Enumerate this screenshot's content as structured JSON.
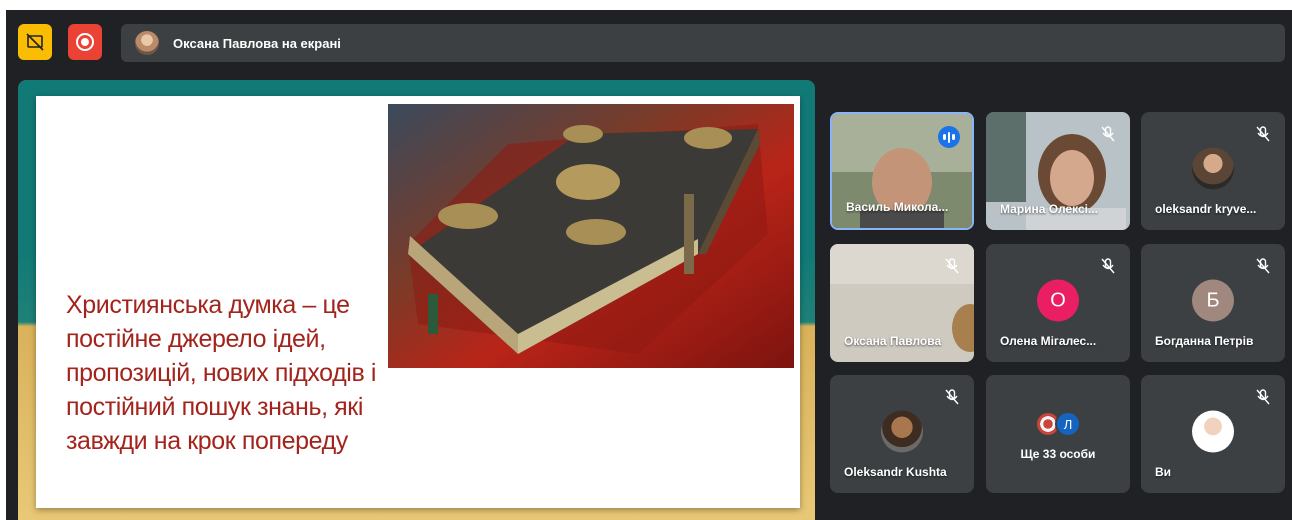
{
  "topbar": {
    "presenter_banner": "Оксана Павлова на екрані",
    "icons": [
      "present-to-all-icon",
      "record-icon"
    ]
  },
  "presentation": {
    "slide_text": "Християнська думка – це постійне джерело ідей, пропозицій, нових підходів і постійний пошук знань, які завжди на крок попереду"
  },
  "participants": [
    {
      "name": "Василь Микола...",
      "state": "speaking"
    },
    {
      "name": "Марина Олексі...",
      "state": "muted"
    },
    {
      "name": "oleksandr kryve...",
      "state": "muted"
    },
    {
      "name": "Оксана Павлова",
      "state": "muted"
    },
    {
      "name": "Олена Мігалес...",
      "initial": "О",
      "state": "muted"
    },
    {
      "name": "Богданна Петрів",
      "initial": "Б",
      "state": "muted"
    },
    {
      "name": "Oleksandr Kushta",
      "state": "muted"
    },
    {
      "more_label": "Ще 33 особи",
      "mini_initial": "Л"
    },
    {
      "name": "Ви",
      "state": "muted"
    }
  ],
  "colors": {
    "background": "#202124",
    "tile": "#3c4043",
    "speaking_border": "#8ab4f8",
    "slide_text": "#a3241c",
    "record": "#ea4335",
    "present": "#fbbc04"
  }
}
